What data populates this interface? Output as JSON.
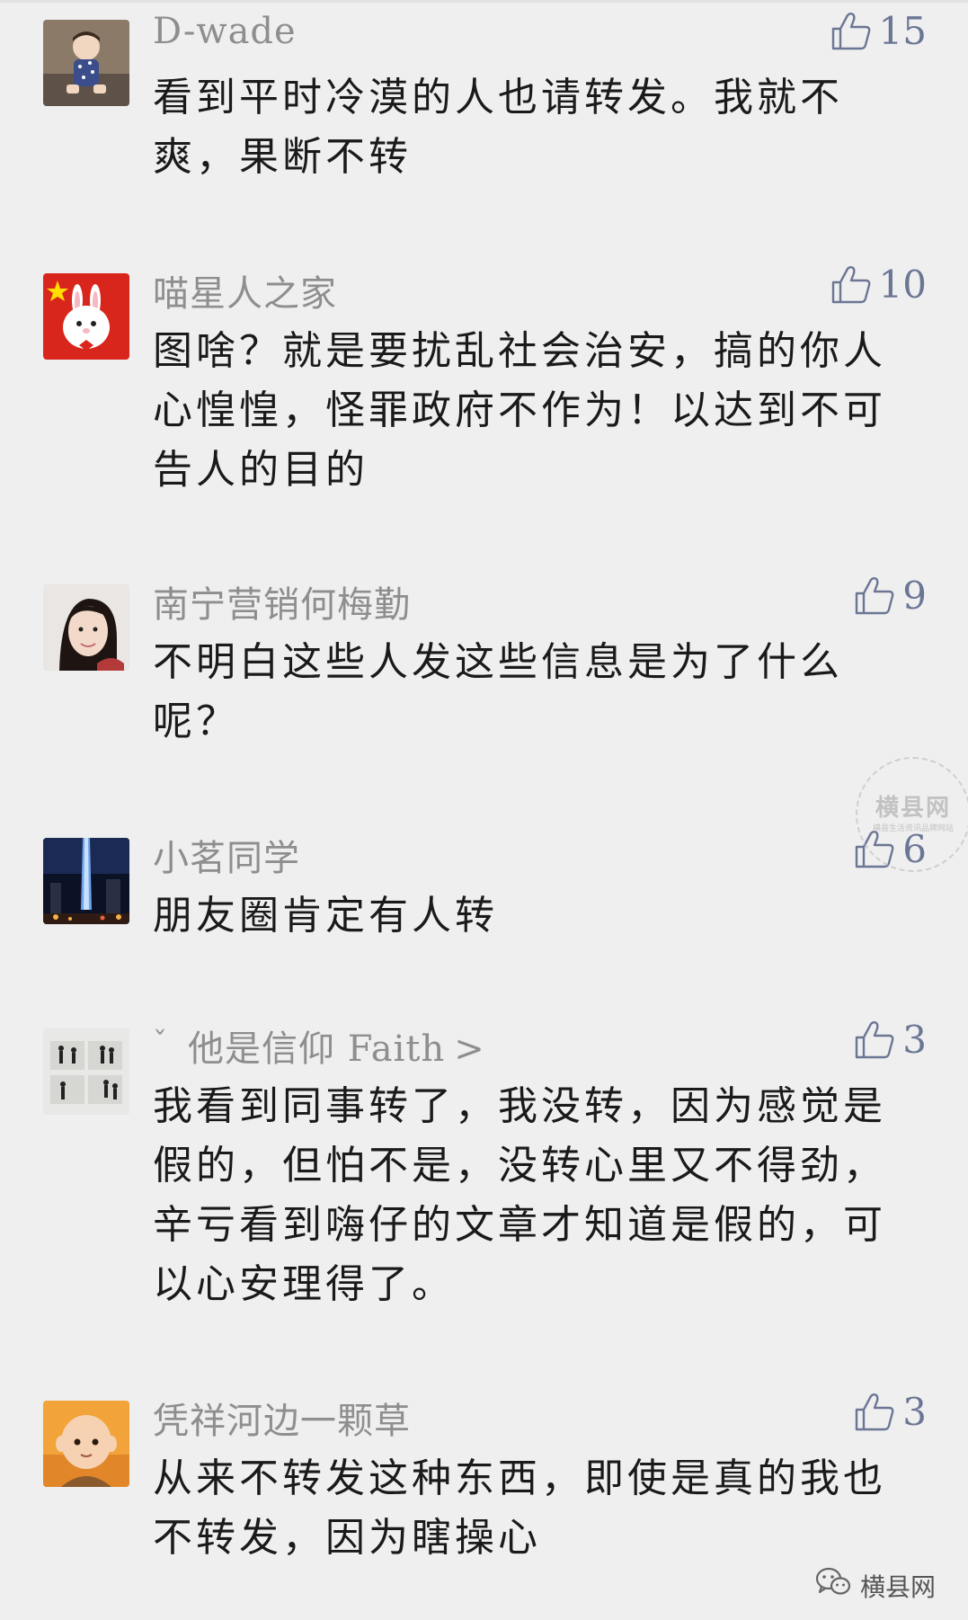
{
  "comments": [
    {
      "name": "D-wade",
      "likes": "15",
      "text": "看到平时冷漠的人也请转发。我就不爽，果断不转",
      "avatar": "baby-photo"
    },
    {
      "name": "喵星人之家",
      "likes": "10",
      "text": "图啥？就是要扰乱社会治安，搞的你人心惶惶，怪罪政府不作为！以达到不可告人的目的",
      "avatar": "flag-bunny"
    },
    {
      "name": "南宁营销何梅勤",
      "likes": "9",
      "text": "不明白这些人发这些信息是为了什么呢？",
      "avatar": "woman-portrait"
    },
    {
      "name": "小茗同学",
      "likes": "6",
      "text": "朋友圈肯定有人转",
      "avatar": "city-night"
    },
    {
      "name_prefix": "ˇ",
      "name": "他是信仰 Faith",
      "name_suffix": ">",
      "likes": "3",
      "text": "我看到同事转了，我没转，因为感觉是假的，但怕不是，没转心里又不得劲，辛亏看到嗨仔的文章才知道是假的，可以心安理得了。",
      "avatar": "silhouette-grid"
    },
    {
      "name": "凭祥河边一颗草",
      "likes": "3",
      "text": "从来不转发这种东西，即使是真的我也不转发，因为瞎操心",
      "avatar": "cartoon-monk"
    }
  ],
  "watermark": {
    "seal_main": "横县网",
    "seal_sub": "横县生活资讯品牌网站",
    "brand_label": "横县网",
    "brand_icon": "wechat-icon"
  },
  "colors": {
    "background": "#efeff0",
    "name": "#8e8e8e",
    "like": "#6b7694",
    "text": "#1a1a1a"
  }
}
